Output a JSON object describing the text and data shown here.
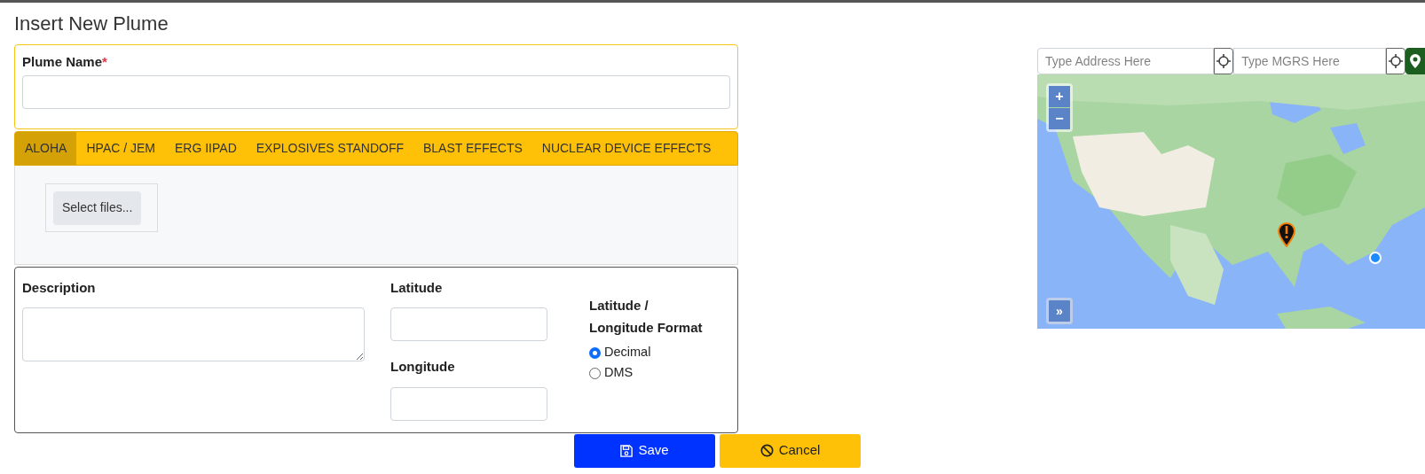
{
  "title": "Insert New Plume",
  "plume_name": {
    "label": "Plume Name",
    "required_mark": "*"
  },
  "tabs": [
    {
      "label": "ALOHA",
      "selected": true
    },
    {
      "label": "HPAC / JEM",
      "selected": false
    },
    {
      "label": "ERG IIPAD",
      "selected": false
    },
    {
      "label": "EXPLOSIVES STANDOFF",
      "selected": false
    },
    {
      "label": "BLAST EFFECTS",
      "selected": false
    },
    {
      "label": "NUCLEAR DEVICE EFFECTS",
      "selected": false
    }
  ],
  "file_button": "Select files...",
  "description": {
    "label": "Description"
  },
  "latitude": {
    "label": "Latitude"
  },
  "longitude": {
    "label": "Longitude"
  },
  "format": {
    "label": "Latitude / Longitude Format",
    "options": [
      {
        "label": "Decimal",
        "selected": true
      },
      {
        "label": "DMS",
        "selected": false
      }
    ]
  },
  "buttons": [
    {
      "kind": "save",
      "label": "Save"
    },
    {
      "kind": "cancel",
      "label": "Cancel"
    }
  ],
  "map": {
    "address_placeholder": "Type Address Here",
    "mgrs_placeholder": "Type MGRS Here",
    "zoom_in": "+",
    "zoom_out": "−",
    "expand": "»"
  }
}
